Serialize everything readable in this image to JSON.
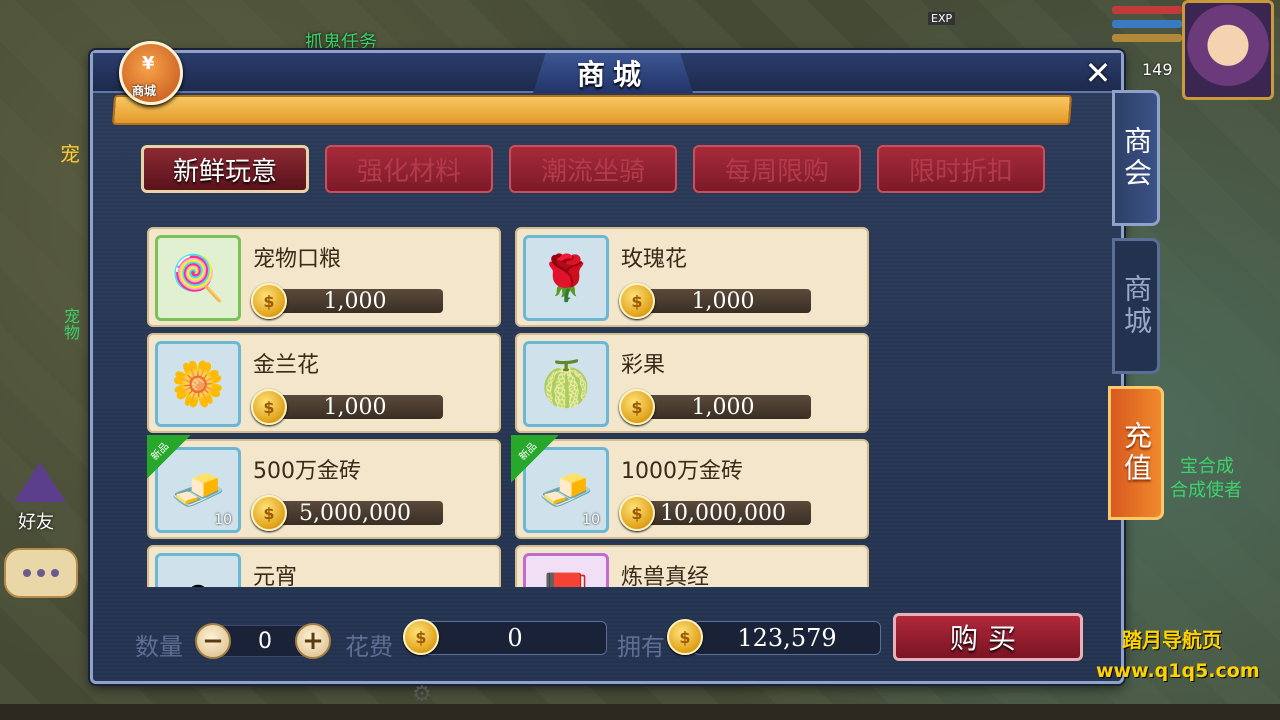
{
  "world": {
    "quest_text": "抓鬼任务",
    "pet_side_text": "宠",
    "pet_side_text2": "宠物",
    "npc_line1": "宝合成",
    "npc_line2": "合成使者",
    "exp_label": "EXP",
    "level": "149",
    "friend_label": "好友"
  },
  "dialog": {
    "title": "商城",
    "badge_label": "商城",
    "badge_glyph": "¥",
    "close_glyph": "✕"
  },
  "tabs": [
    {
      "label": "新鲜玩意",
      "active": true
    },
    {
      "label": "强化材料",
      "active": false
    },
    {
      "label": "潮流坐骑",
      "active": false
    },
    {
      "label": "每周限购",
      "active": false
    },
    {
      "label": "限时折扣",
      "active": false
    }
  ],
  "items": [
    {
      "name": "宠物口粮",
      "price": "1,000",
      "icon": "lollipop-icon",
      "glyph": "🍭",
      "frame": "green"
    },
    {
      "name": "玫瑰花",
      "price": "1,000",
      "icon": "rose-icon",
      "glyph": "🌹",
      "frame": "blue"
    },
    {
      "name": "金兰花",
      "price": "1,000",
      "icon": "gold-flower-icon",
      "glyph": "🌼",
      "frame": "blue"
    },
    {
      "name": "彩果",
      "price": "1,000",
      "icon": "rainbow-fruit-icon",
      "glyph": "🍈",
      "frame": "blue"
    },
    {
      "name": "500万金砖",
      "price": "5,000,000",
      "icon": "gold-brick-icon",
      "glyph": "🧈",
      "frame": "blue",
      "new_tag": "新品",
      "qty": "10"
    },
    {
      "name": "1000万金砖",
      "price": "10,000,000",
      "icon": "gold-brick-icon",
      "glyph": "🧈",
      "frame": "blue",
      "new_tag": "新品",
      "qty": "10"
    },
    {
      "name": "元宵",
      "price": "",
      "icon": "rice-ball-icon",
      "glyph": "⚪",
      "frame": "blue"
    },
    {
      "name": "炼兽真经",
      "price": "",
      "icon": "scripture-icon",
      "glyph": "📕",
      "frame": "purple"
    }
  ],
  "side_tabs": {
    "guild": "商会",
    "mall": "商城",
    "recharge": "充值"
  },
  "bottom": {
    "count_label": "数量",
    "count_value": "0",
    "cost_label": "花费",
    "cost_value": "0",
    "own_label": "拥有",
    "own_value": "123,579",
    "buy_label": "购买",
    "minus": "−",
    "plus": "+"
  },
  "coin_glyph": "$",
  "watermark": {
    "line1": "踏月导航页",
    "line2": "www.q1q5.com"
  },
  "colors": {
    "dialog_bg": "#23324f",
    "tab_red": "#7b1a28",
    "card_bg": "#f3e6cb",
    "gold": "#e0a118",
    "recharge_orange": "#f08a2c"
  }
}
